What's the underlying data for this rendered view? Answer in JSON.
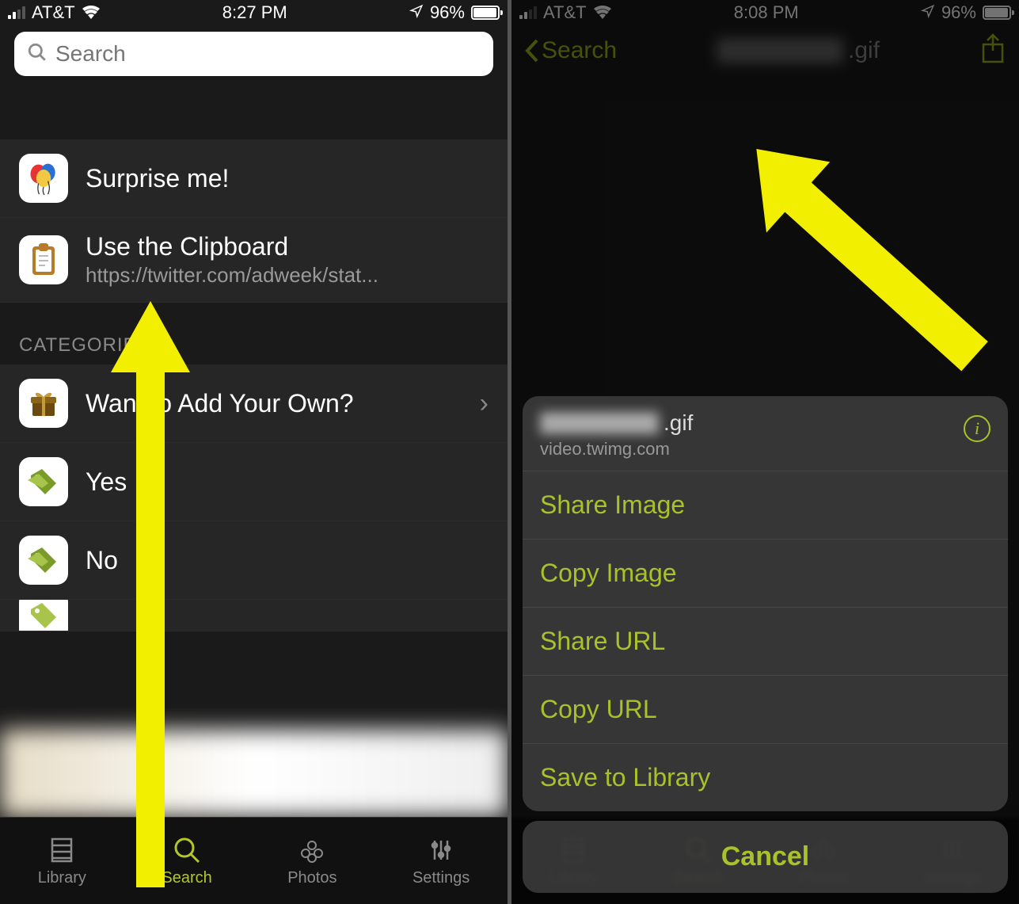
{
  "status": {
    "carrier": "AT&T",
    "time_left": "8:27 PM",
    "time_right": "8:08 PM",
    "battery_pct": "96%"
  },
  "left": {
    "search_placeholder": "Search",
    "surprise": "Surprise me!",
    "clipboard_title": "Use the Clipboard",
    "clipboard_sub": "https://twitter.com/adweek/stat...",
    "categories_header": "CATEGORIES",
    "add_own": "Want to Add Your Own?",
    "yes": "Yes",
    "no": "No"
  },
  "right": {
    "back": "Search",
    "title_ext": ".gif",
    "sheet": {
      "filename_ext": ".gif",
      "host": "video.twimg.com",
      "items": [
        "Share Image",
        "Copy Image",
        "Share URL",
        "Copy URL",
        "Save to Library"
      ],
      "cancel": "Cancel"
    }
  },
  "tabs": [
    "Library",
    "Search",
    "Photos",
    "Settings"
  ],
  "accent": "#9db315"
}
